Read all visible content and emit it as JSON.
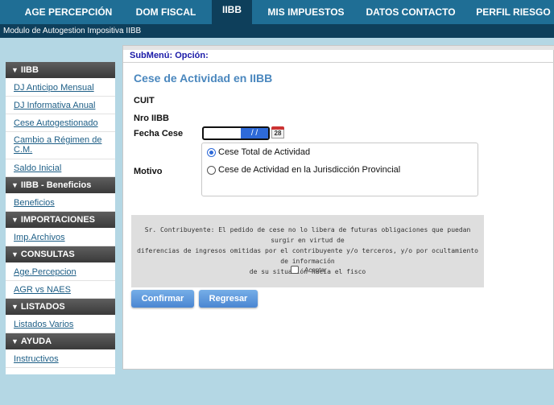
{
  "nav": {
    "items": [
      {
        "label": "AGE PERCEPCIÓN"
      },
      {
        "label": "DOM FISCAL"
      },
      {
        "label": "IIBB"
      },
      {
        "label": "MIS IMPUESTOS"
      },
      {
        "label": "DATOS CONTACTO"
      },
      {
        "label": "PERFIL RIESGO"
      }
    ],
    "active": "IIBB"
  },
  "subtitle": "Modulo de Autogestion Impositiva IIBB",
  "sidebar": {
    "sections": [
      {
        "title": "IIBB",
        "items": [
          "DJ Anticipo Mensual",
          "DJ Informativa Anual",
          "Cese Autogestionado",
          "Cambio a Régimen de C.M.",
          "Saldo Inicial"
        ]
      },
      {
        "title": "IIBB - Beneficios",
        "items": [
          "Beneficios"
        ]
      },
      {
        "title": "IMPORTACIONES",
        "items": [
          "Imp.Archivos"
        ]
      },
      {
        "title": "CONSULTAS",
        "items": [
          "Age.Percepcion",
          "AGR vs NAES"
        ]
      },
      {
        "title": "LISTADOS",
        "items": [
          "Listados Varios"
        ]
      },
      {
        "title": "AYUDA",
        "items": [
          "Instructivos"
        ]
      }
    ]
  },
  "main": {
    "submenu": "SubMenú: Opción:",
    "title": "Cese de Actividad en IIBB",
    "labels": {
      "cuit": "CUIT",
      "nro_iibb": "Nro IIBB",
      "fecha_cese": "Fecha Cese",
      "motivo": "Motivo"
    },
    "fecha_value": "/ /",
    "calendar_day": "28",
    "motivo_options": [
      {
        "label": "Cese Total de Actividad",
        "checked": true
      },
      {
        "label": "Cese de Actividad en la Jurisdicción Provincial",
        "checked": false
      }
    ],
    "notice": {
      "lines": [
        "Sr. Contribuyente: El pedido de cese no lo libera de futuras obligaciones que puedan surgir en virtud de",
        "diferencias de ingresos omitidas por el contribuyente y/o terceros, y/o por ocultamiento de información",
        "de su situación hacia el fisco"
      ],
      "accept_label": "Aceptar"
    },
    "buttons": {
      "confirm": "Confirmar",
      "back": "Regresar"
    }
  },
  "colors": {
    "nav_bg": "#1f6e95",
    "nav_active": "#0e3f5b",
    "title": "#4a87be",
    "button": "#4a86d2",
    "background": "#b4d7e4"
  }
}
